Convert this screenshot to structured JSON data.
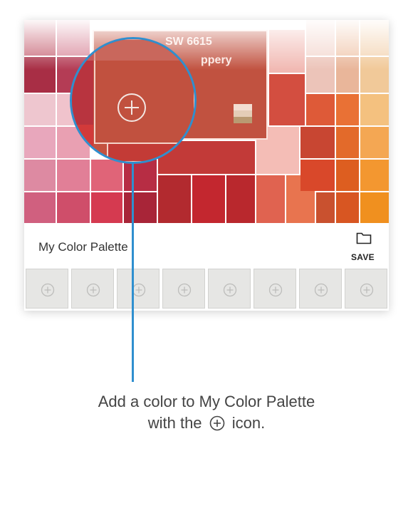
{
  "swatch": {
    "code": "SW 6615",
    "name": "ppery"
  },
  "palette": {
    "title": "My Color Palette",
    "save_label": "SAVE",
    "slot_count": 8
  },
  "caption": {
    "line1": "Add a color to My Color Palette",
    "line2_prefix": "with the",
    "line2_suffix": "icon."
  },
  "colors": {
    "accent": "#2f8fcf",
    "featured_swatch": "#c15240"
  }
}
